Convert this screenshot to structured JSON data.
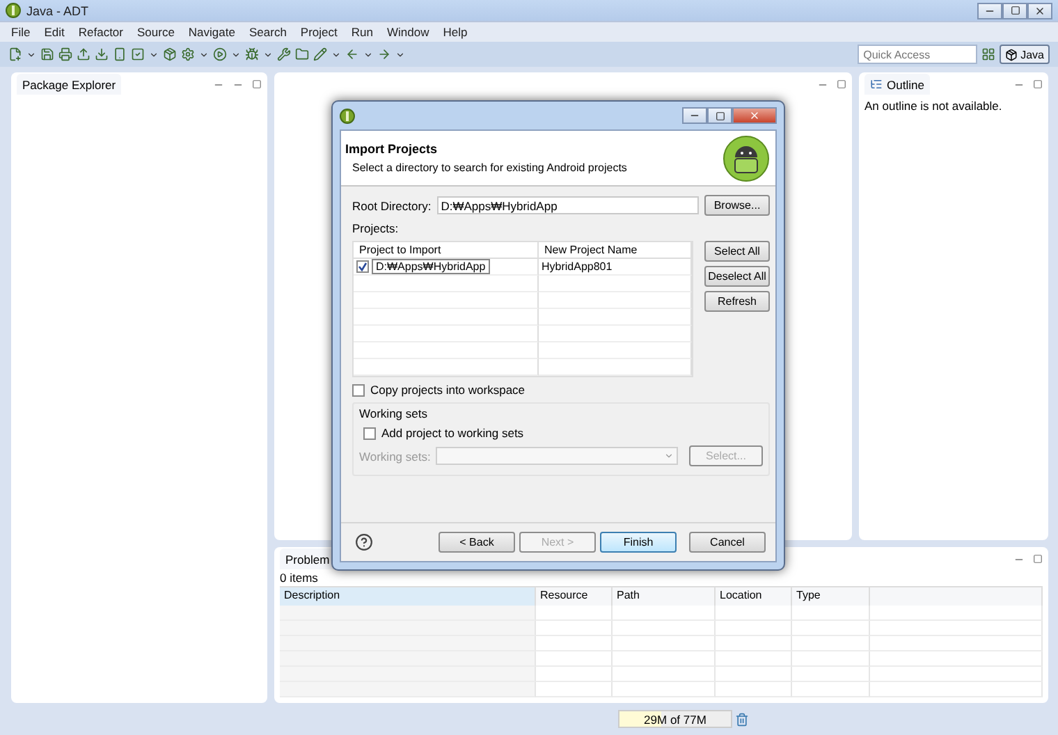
{
  "window": {
    "title": "Java - ADT"
  },
  "menu": [
    "File",
    "Edit",
    "Refactor",
    "Source",
    "Navigate",
    "Search",
    "Project",
    "Run",
    "Window",
    "Help"
  ],
  "quick_access": {
    "placeholder": "Quick Access"
  },
  "perspective": {
    "label": "Java",
    "selected": true
  },
  "package_explorer": {
    "title": "Package Explorer"
  },
  "outline": {
    "title": "Outline",
    "message": "An outline is not available."
  },
  "problems": {
    "title": "Problem",
    "count": "0 items",
    "columns": [
      "Description",
      "Resource",
      "Path",
      "Location",
      "Type"
    ]
  },
  "status": {
    "memory": "29M of 77M",
    "level": 0.38
  },
  "dialog": {
    "title": "Import Projects",
    "subtitle": "Select a directory to search for existing Android projects",
    "root_label": "Root Directory:",
    "root_value": "D:₩Apps₩HybridApp",
    "browse": "Browse...",
    "projects_label": "Projects:",
    "columns": [
      "Project to Import",
      "New Project Name"
    ],
    "rows": [
      {
        "project": "D:₩Apps₩HybridApp",
        "name": "HybridApp801",
        "checked": true
      }
    ],
    "side_buttons": [
      "Select All",
      "Deselect All",
      "Refresh"
    ],
    "copy": {
      "label": "Copy projects into workspace",
      "checked": false
    },
    "working_sets": {
      "title": "Working sets",
      "add_label": "Add project to working sets",
      "checked": false,
      "field_label": "Working sets:",
      "select": "Select...",
      "disabled": true
    },
    "buttons": [
      {
        "label": "< Back",
        "disabled": false,
        "default": false
      },
      {
        "label": "Next >",
        "disabled": true,
        "default": false
      },
      {
        "label": "Finish",
        "disabled": false,
        "default": true
      },
      {
        "label": "Cancel",
        "disabled": false,
        "default": false
      }
    ]
  }
}
